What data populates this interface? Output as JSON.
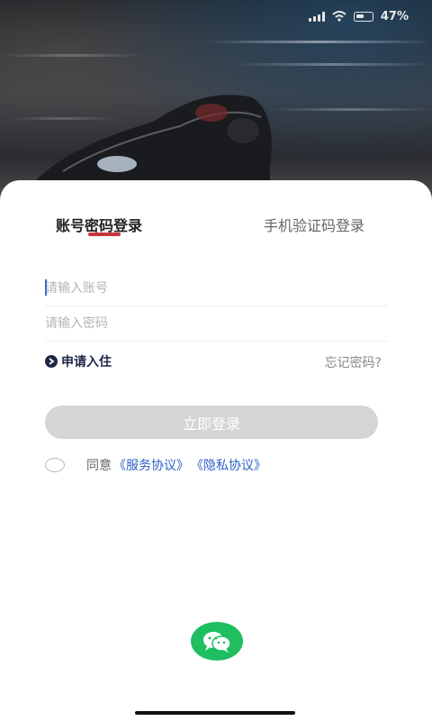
{
  "status": {
    "battery": "47%"
  },
  "tabs": [
    {
      "label": "账号密码登录",
      "active": true
    },
    {
      "label": "手机验证码登录",
      "active": false
    }
  ],
  "form": {
    "account_placeholder": "请输入账号",
    "password_placeholder": "请输入密码"
  },
  "apply_label": "申请入住",
  "forgot_label": "忘记密码?",
  "login_button": "立即登录",
  "agreement": {
    "prefix": "同意",
    "service": "《服务协议》",
    "privacy": "《隐私协议》"
  },
  "colors": {
    "accent_underline": "#c8343f",
    "link": "#2c62c8",
    "wechat": "#1fbf61",
    "button_disabled": "#d5d5d5"
  },
  "icons": {
    "wechat": "wechat-icon",
    "apply": "arrow-right-circle-icon"
  }
}
